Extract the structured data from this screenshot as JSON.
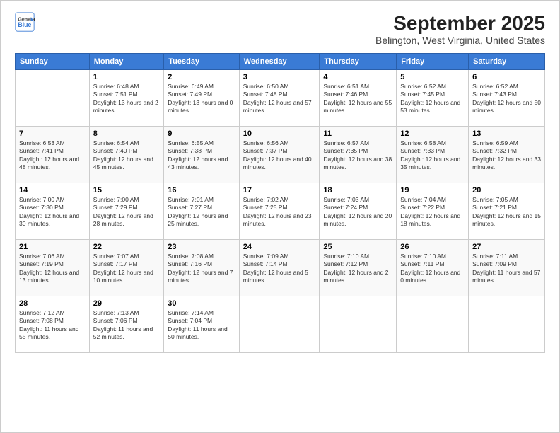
{
  "logo": {
    "general": "General",
    "blue": "Blue"
  },
  "title": "September 2025",
  "subtitle": "Belington, West Virginia, United States",
  "headers": [
    "Sunday",
    "Monday",
    "Tuesday",
    "Wednesday",
    "Thursday",
    "Friday",
    "Saturday"
  ],
  "weeks": [
    [
      {
        "day": "",
        "sunrise": "",
        "sunset": "",
        "daylight": ""
      },
      {
        "day": "1",
        "sunrise": "Sunrise: 6:48 AM",
        "sunset": "Sunset: 7:51 PM",
        "daylight": "Daylight: 13 hours and 2 minutes."
      },
      {
        "day": "2",
        "sunrise": "Sunrise: 6:49 AM",
        "sunset": "Sunset: 7:49 PM",
        "daylight": "Daylight: 13 hours and 0 minutes."
      },
      {
        "day": "3",
        "sunrise": "Sunrise: 6:50 AM",
        "sunset": "Sunset: 7:48 PM",
        "daylight": "Daylight: 12 hours and 57 minutes."
      },
      {
        "day": "4",
        "sunrise": "Sunrise: 6:51 AM",
        "sunset": "Sunset: 7:46 PM",
        "daylight": "Daylight: 12 hours and 55 minutes."
      },
      {
        "day": "5",
        "sunrise": "Sunrise: 6:52 AM",
        "sunset": "Sunset: 7:45 PM",
        "daylight": "Daylight: 12 hours and 53 minutes."
      },
      {
        "day": "6",
        "sunrise": "Sunrise: 6:52 AM",
        "sunset": "Sunset: 7:43 PM",
        "daylight": "Daylight: 12 hours and 50 minutes."
      }
    ],
    [
      {
        "day": "7",
        "sunrise": "Sunrise: 6:53 AM",
        "sunset": "Sunset: 7:41 PM",
        "daylight": "Daylight: 12 hours and 48 minutes."
      },
      {
        "day": "8",
        "sunrise": "Sunrise: 6:54 AM",
        "sunset": "Sunset: 7:40 PM",
        "daylight": "Daylight: 12 hours and 45 minutes."
      },
      {
        "day": "9",
        "sunrise": "Sunrise: 6:55 AM",
        "sunset": "Sunset: 7:38 PM",
        "daylight": "Daylight: 12 hours and 43 minutes."
      },
      {
        "day": "10",
        "sunrise": "Sunrise: 6:56 AM",
        "sunset": "Sunset: 7:37 PM",
        "daylight": "Daylight: 12 hours and 40 minutes."
      },
      {
        "day": "11",
        "sunrise": "Sunrise: 6:57 AM",
        "sunset": "Sunset: 7:35 PM",
        "daylight": "Daylight: 12 hours and 38 minutes."
      },
      {
        "day": "12",
        "sunrise": "Sunrise: 6:58 AM",
        "sunset": "Sunset: 7:33 PM",
        "daylight": "Daylight: 12 hours and 35 minutes."
      },
      {
        "day": "13",
        "sunrise": "Sunrise: 6:59 AM",
        "sunset": "Sunset: 7:32 PM",
        "daylight": "Daylight: 12 hours and 33 minutes."
      }
    ],
    [
      {
        "day": "14",
        "sunrise": "Sunrise: 7:00 AM",
        "sunset": "Sunset: 7:30 PM",
        "daylight": "Daylight: 12 hours and 30 minutes."
      },
      {
        "day": "15",
        "sunrise": "Sunrise: 7:00 AM",
        "sunset": "Sunset: 7:29 PM",
        "daylight": "Daylight: 12 hours and 28 minutes."
      },
      {
        "day": "16",
        "sunrise": "Sunrise: 7:01 AM",
        "sunset": "Sunset: 7:27 PM",
        "daylight": "Daylight: 12 hours and 25 minutes."
      },
      {
        "day": "17",
        "sunrise": "Sunrise: 7:02 AM",
        "sunset": "Sunset: 7:25 PM",
        "daylight": "Daylight: 12 hours and 23 minutes."
      },
      {
        "day": "18",
        "sunrise": "Sunrise: 7:03 AM",
        "sunset": "Sunset: 7:24 PM",
        "daylight": "Daylight: 12 hours and 20 minutes."
      },
      {
        "day": "19",
        "sunrise": "Sunrise: 7:04 AM",
        "sunset": "Sunset: 7:22 PM",
        "daylight": "Daylight: 12 hours and 18 minutes."
      },
      {
        "day": "20",
        "sunrise": "Sunrise: 7:05 AM",
        "sunset": "Sunset: 7:21 PM",
        "daylight": "Daylight: 12 hours and 15 minutes."
      }
    ],
    [
      {
        "day": "21",
        "sunrise": "Sunrise: 7:06 AM",
        "sunset": "Sunset: 7:19 PM",
        "daylight": "Daylight: 12 hours and 13 minutes."
      },
      {
        "day": "22",
        "sunrise": "Sunrise: 7:07 AM",
        "sunset": "Sunset: 7:17 PM",
        "daylight": "Daylight: 12 hours and 10 minutes."
      },
      {
        "day": "23",
        "sunrise": "Sunrise: 7:08 AM",
        "sunset": "Sunset: 7:16 PM",
        "daylight": "Daylight: 12 hours and 7 minutes."
      },
      {
        "day": "24",
        "sunrise": "Sunrise: 7:09 AM",
        "sunset": "Sunset: 7:14 PM",
        "daylight": "Daylight: 12 hours and 5 minutes."
      },
      {
        "day": "25",
        "sunrise": "Sunrise: 7:10 AM",
        "sunset": "Sunset: 7:12 PM",
        "daylight": "Daylight: 12 hours and 2 minutes."
      },
      {
        "day": "26",
        "sunrise": "Sunrise: 7:10 AM",
        "sunset": "Sunset: 7:11 PM",
        "daylight": "Daylight: 12 hours and 0 minutes."
      },
      {
        "day": "27",
        "sunrise": "Sunrise: 7:11 AM",
        "sunset": "Sunset: 7:09 PM",
        "daylight": "Daylight: 11 hours and 57 minutes."
      }
    ],
    [
      {
        "day": "28",
        "sunrise": "Sunrise: 7:12 AM",
        "sunset": "Sunset: 7:08 PM",
        "daylight": "Daylight: 11 hours and 55 minutes."
      },
      {
        "day": "29",
        "sunrise": "Sunrise: 7:13 AM",
        "sunset": "Sunset: 7:06 PM",
        "daylight": "Daylight: 11 hours and 52 minutes."
      },
      {
        "day": "30",
        "sunrise": "Sunrise: 7:14 AM",
        "sunset": "Sunset: 7:04 PM",
        "daylight": "Daylight: 11 hours and 50 minutes."
      },
      {
        "day": "",
        "sunrise": "",
        "sunset": "",
        "daylight": ""
      },
      {
        "day": "",
        "sunrise": "",
        "sunset": "",
        "daylight": ""
      },
      {
        "day": "",
        "sunrise": "",
        "sunset": "",
        "daylight": ""
      },
      {
        "day": "",
        "sunrise": "",
        "sunset": "",
        "daylight": ""
      }
    ]
  ]
}
